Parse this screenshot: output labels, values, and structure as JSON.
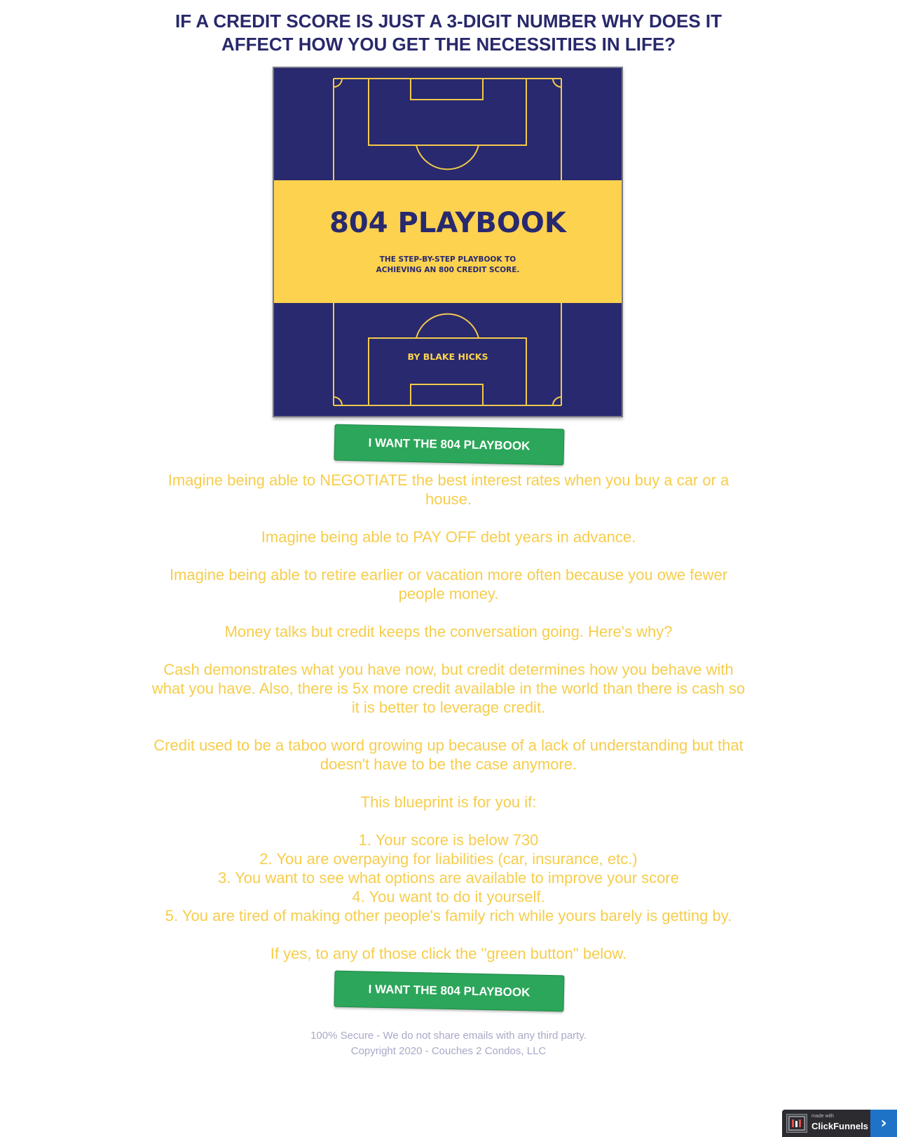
{
  "headline": {
    "line1": "IF A CREDIT SCORE IS JUST A 3-DIGIT NUMBER WHY DOES IT",
    "line2": "AFFECT HOW YOU GET THE NECESSITIES IN LIFE?"
  },
  "book": {
    "title": "804 PLAYBOOK",
    "subtitle_line1": "THE STEP-BY-STEP PLAYBOOK TO",
    "subtitle_line2": "ACHIEVING AN 800 CREDIT SCORE.",
    "author": "BY BLAKE HICKS"
  },
  "cta": {
    "label": "I WANT THE 804 PLAYBOOK"
  },
  "copy": {
    "p1": "Imagine being able to NEGOTIATE the best interest rates when you buy a car or a house.",
    "p2": "Imagine being able to PAY OFF debt years in advance.",
    "p3": "Imagine being able to retire earlier or vacation more often because you owe fewer people money.",
    "p4": "Money talks but credit keeps the conversation going. Here's why?",
    "p5": "Cash demonstrates what you have now, but credit determines how you behave with what you have. Also, there is 5x more credit available in the world than there is cash so it is better to leverage credit.",
    "p6": "Credit used to be a taboo word growing up because of a lack of understanding but that doesn't have to be the case anymore.",
    "p7": "This blueprint is for you if:",
    "list": [
      "1. Your score is below 730",
      "2. You are overpaying for liabilities (car, insurance, etc.)",
      "3. You want to see what options are available to improve your score",
      "4. You want to do it yourself.",
      "5. You are tired of making other people's family rich while yours barely is getting by."
    ],
    "p8": "If yes, to any of those click the \"green button\" below."
  },
  "footer": {
    "secure": "100% Secure - We do not share emails with any third party.",
    "copyright": "Copyright 2020 - Couches 2 Condos, LLC"
  },
  "badge": {
    "made_with": "made with",
    "brand": "ClickFunnels",
    "arrow": "›"
  },
  "colors": {
    "navy": "#28286b",
    "gold": "#f6cd4c",
    "green": "#2ba65a",
    "footer_text": "#a8a8c8",
    "badge_blue": "#1f73c7"
  }
}
